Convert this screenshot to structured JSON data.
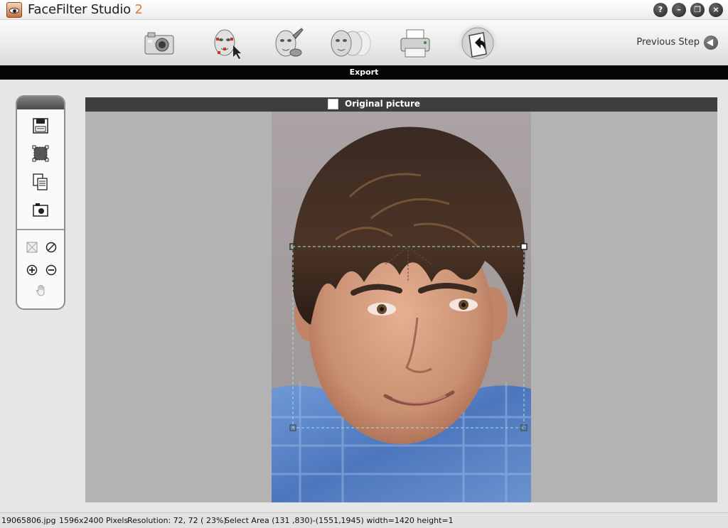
{
  "app": {
    "name": "FaceFilter Studio ",
    "version": "2"
  },
  "window_controls": [
    {
      "name": "help-button",
      "icon": "question-icon",
      "glyph": "?"
    },
    {
      "name": "minimize-button",
      "icon": "minimize-icon",
      "glyph": "–"
    },
    {
      "name": "restore-button",
      "icon": "restore-icon",
      "glyph": "❐"
    },
    {
      "name": "close-button",
      "icon": "close-icon",
      "glyph": "×"
    }
  ],
  "toolbar": {
    "tools": [
      {
        "name": "open-camera",
        "icon": "camera-icon"
      },
      {
        "name": "face-markers",
        "icon": "face-markers-icon"
      },
      {
        "name": "face-edit",
        "icon": "face-brush-icon"
      },
      {
        "name": "face-morph",
        "icon": "faces-morph-icon"
      },
      {
        "name": "print",
        "icon": "printer-icon"
      },
      {
        "name": "export",
        "icon": "export-icon",
        "active": true
      }
    ],
    "previous_step": "Previous Step"
  },
  "step_title": "Export",
  "palette": {
    "tools": [
      "save-icon",
      "select-area-icon",
      "copy-icon",
      "snapshot-icon"
    ],
    "view_tools": [
      "fit-icon",
      "reset-icon",
      "zoom-in-icon",
      "zoom-out-icon",
      "hand-pan-icon"
    ]
  },
  "panel": {
    "label": "Original picture",
    "checked": false
  },
  "status": {
    "filename": "19065806.jpg",
    "dimensions": "1596x2400 Pixels",
    "resolution": "Resolution: 72, 72 ( 23%)",
    "selection": "Select Area (131 ,830)-(1551,1945) width=1420  height=1"
  },
  "colors": {
    "accent_version": "#e8772e",
    "step_bar": "#050505",
    "panel_header": "#3e3e3e",
    "panel_bg": "#b3b3b3",
    "selection_line": "#7fd8d0"
  }
}
